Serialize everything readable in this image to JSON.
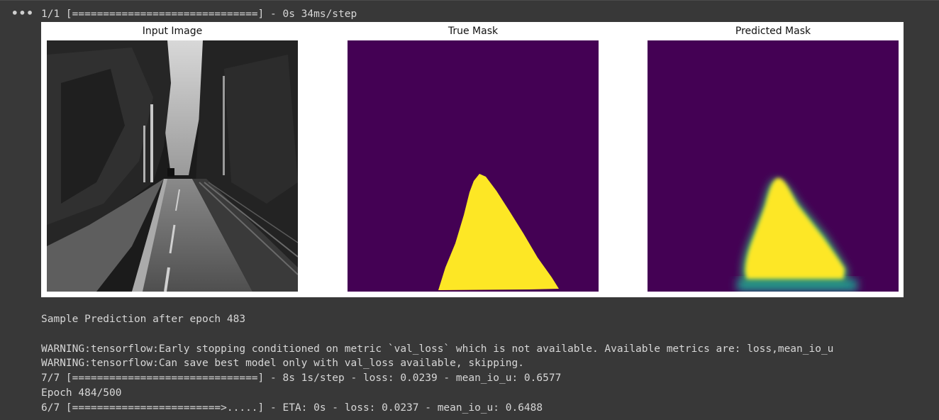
{
  "cell": {
    "menu_glyph": "•••",
    "progress_line": "1/1 [==============================] - 0s 34ms/step"
  },
  "figure": {
    "panels": [
      {
        "title": "Input Image"
      },
      {
        "title": "True Mask"
      },
      {
        "title": "Predicted Mask"
      }
    ],
    "colors": {
      "mask_background": "#440154",
      "mask_foreground": "#fde725",
      "mask_edge": "#35b779"
    }
  },
  "log": {
    "sample": "Sample Prediction after epoch 483",
    "warning_early_stopping": "WARNING:tensorflow:Early stopping conditioned on metric `val_loss` which is not available. Available metrics are: loss,mean_io_u",
    "warning_checkpoint": "WARNING:tensorflow:Can save best model only with val_loss available, skipping.",
    "step_line": "7/7 [==============================] - 8s 1s/step - loss: 0.0239 - mean_io_u: 0.6577",
    "epoch_line": "Epoch 484/500",
    "progress_line": "6/7 [========================>.....] - ETA: 0s - loss: 0.0237 - mean_io_u: 0.6488"
  }
}
